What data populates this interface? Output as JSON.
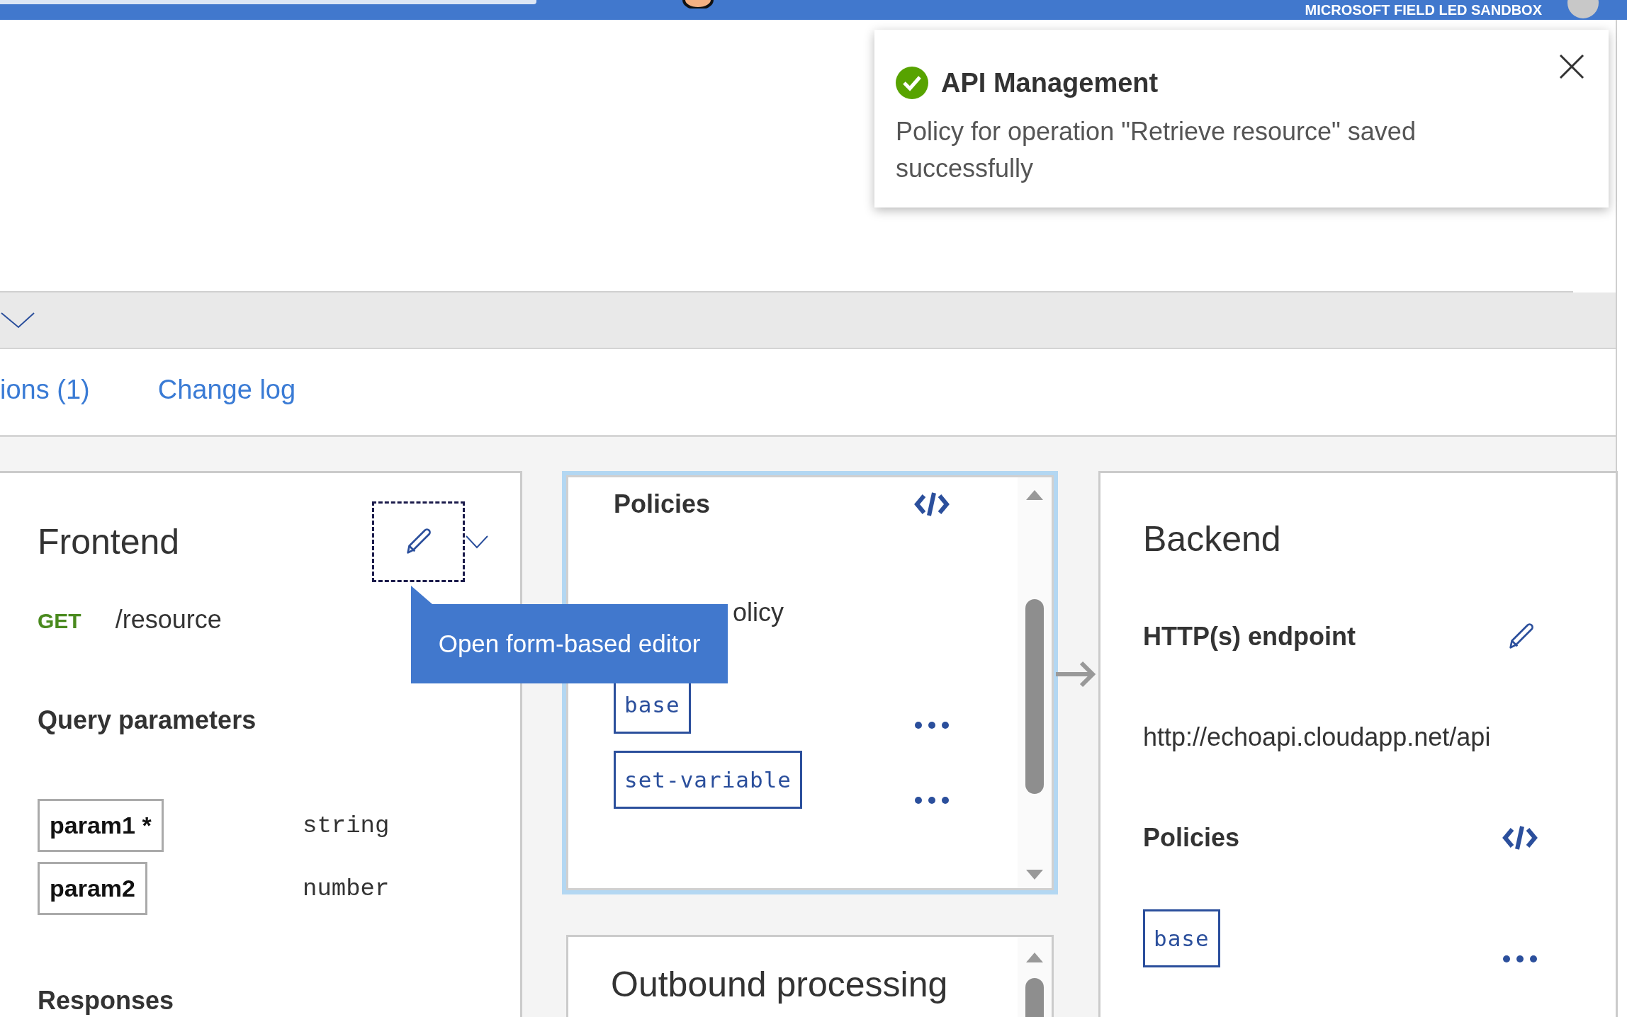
{
  "top_bar": {
    "account": "MICROSOFT FIELD LED SANDBOX"
  },
  "toast": {
    "title": "API Management",
    "message": "Policy for operation \"Retrieve resource\" saved successfully"
  },
  "tabs": [
    {
      "label": "ions (1)",
      "selected": false
    },
    {
      "label": "Change log",
      "selected": false
    }
  ],
  "frontend": {
    "title": "Frontend",
    "method": "GET",
    "path": "/resource",
    "query_title": "Query parameters",
    "params": [
      {
        "name": "param1 *",
        "type": "string"
      },
      {
        "name": "param2",
        "type": "number"
      }
    ],
    "responses_title": "Responses"
  },
  "tooltip": {
    "text": "Open form-based editor"
  },
  "inbound": {
    "title": "Policies",
    "add_policy": "olicy",
    "policies": [
      "base",
      "set-variable"
    ]
  },
  "outbound": {
    "title": "Outbound processing"
  },
  "backend": {
    "title": "Backend",
    "endpoint_title": "HTTP(s) endpoint",
    "url": "http://echoapi.cloudapp.net/api",
    "policies_title": "Policies",
    "policies": [
      "base"
    ]
  }
}
